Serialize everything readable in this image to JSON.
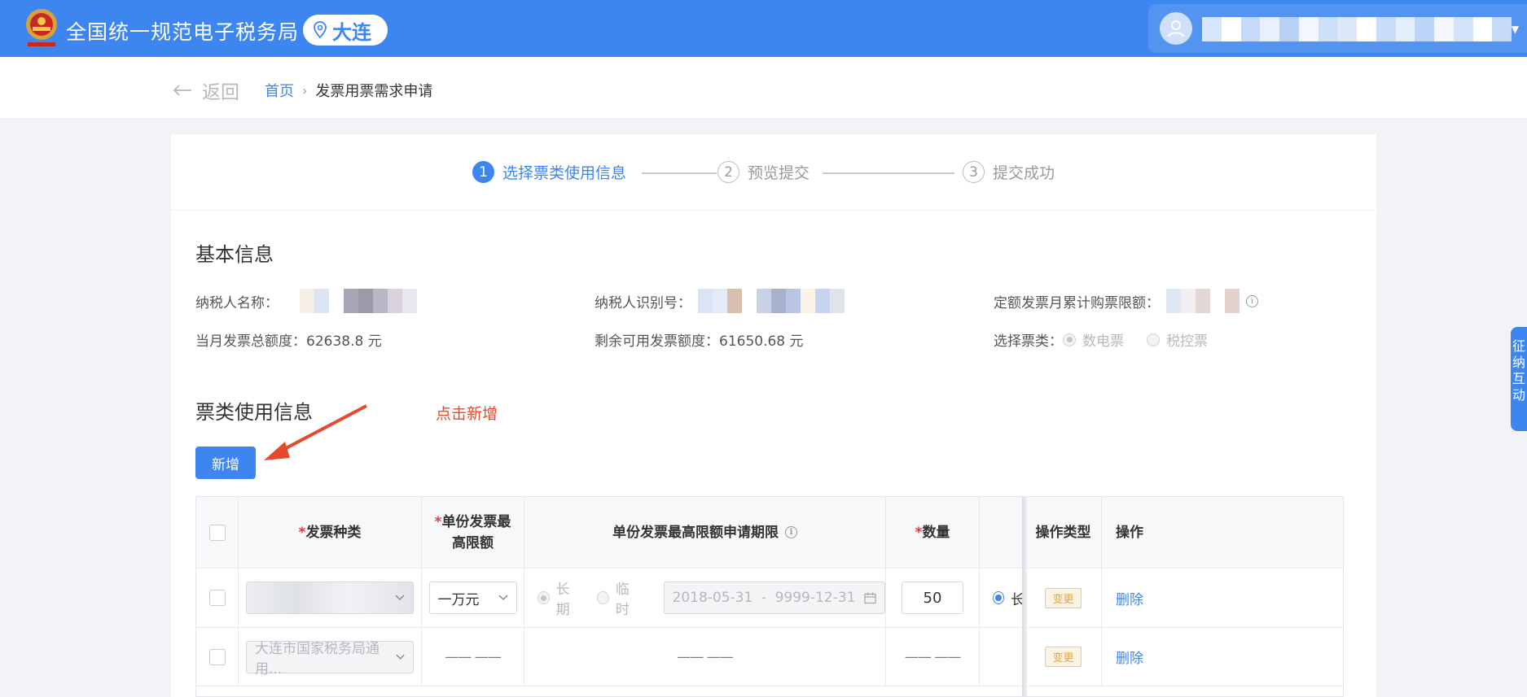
{
  "header": {
    "brand": "全国统一规范电子税务局",
    "city": "大连",
    "colors": {
      "primary": "#3d86f0"
    }
  },
  "breadcrumb": {
    "back": "返回",
    "home": "首页",
    "separator": "›",
    "current": "发票用票需求申请"
  },
  "steps": [
    {
      "num": "1",
      "label": "选择票类使用信息",
      "state": "active"
    },
    {
      "num": "2",
      "label": "预览提交",
      "state": "idle"
    },
    {
      "num": "3",
      "label": "提交成功",
      "state": "idle"
    }
  ],
  "basic_info": {
    "title": "基本信息",
    "taxpayer_name_label": "纳税人名称：",
    "taxpayer_id_label": "纳税人识别号：",
    "quota_label": "定额发票月累计购票限额：",
    "month_total": "当月发票总额度：62638.8 元",
    "remaining": "剩余可用发票额度：61650.68 元",
    "ticket_type_label": "选择票类：",
    "ticket_options": [
      "数电票",
      "税控票"
    ]
  },
  "usage": {
    "title": "票类使用信息",
    "add_button": "新增",
    "annotation": "点击新增"
  },
  "table": {
    "headers": {
      "invoice_type": "发票种类",
      "max_amount": "单份发票最高限额",
      "period": "单份发票最高限额申请期限",
      "quantity": "数量",
      "op_type": "操作类型",
      "op": "操作"
    },
    "rows": [
      {
        "invoice_type": "",
        "max_amount": "一万元",
        "period_options": [
          "长期",
          "临时"
        ],
        "date_start": "2018-05-31",
        "date_sep": "-",
        "date_end": "9999-12-31",
        "quantity": "50",
        "extra": "长",
        "op_type": "变更",
        "op": "删除"
      },
      {
        "invoice_type": "大连市国家税务局通用...",
        "max_amount": "—— ——",
        "period": "—— ——",
        "quantity": "—— ——",
        "op_type": "变更",
        "op": "删除"
      }
    ]
  },
  "side_tab": "征纳互动"
}
